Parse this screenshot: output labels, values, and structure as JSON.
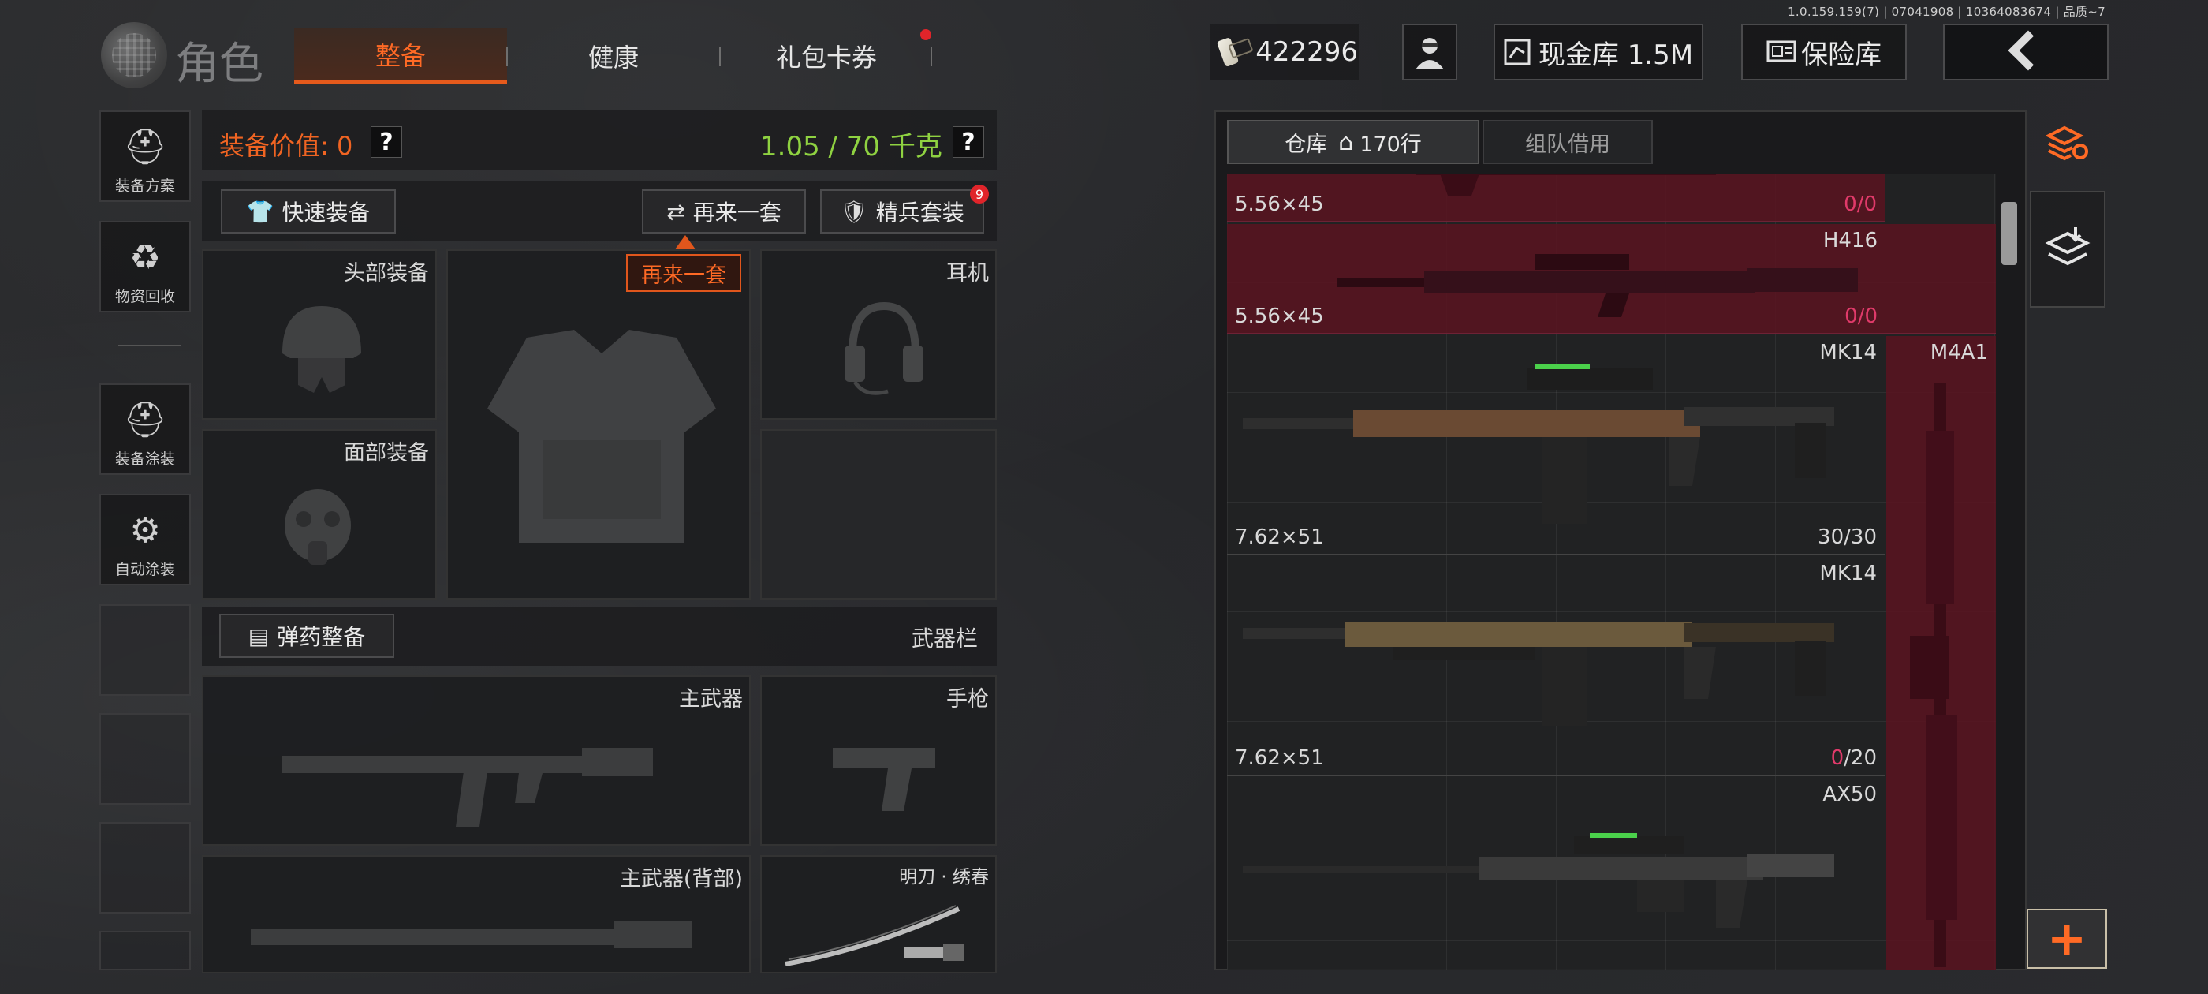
{
  "version": "1.0.159.159(7) | 07041908 | 10364083674 | 品质~7",
  "header": {
    "title": "角色",
    "tabs": [
      {
        "label": "整备",
        "active": true
      },
      {
        "label": "健康",
        "active": false
      },
      {
        "label": "礼包卡券",
        "active": false,
        "has_notification": true
      }
    ],
    "currency": "422296",
    "cash_vault": "现金库 1.5M",
    "safe_box": "保险库"
  },
  "sidebar": {
    "items": [
      {
        "label": "装备方案",
        "icon": "helmet-grid-icon"
      },
      {
        "label": "物资回收",
        "icon": "recycle-face-icon"
      },
      {
        "label": "装备涂装",
        "icon": "helmet-brush-icon"
      },
      {
        "label": "自动涂装",
        "icon": "brush-gear-icon"
      }
    ]
  },
  "equipment": {
    "value_label": "装备价值: 0",
    "weight_label": "1.05 / 70 千克",
    "help_symbol": "?",
    "quick_equip": "快速装备",
    "again_set": "再来一套",
    "elite_set": "精兵套装",
    "elite_badge": "9",
    "tooltip": "再来一套",
    "slots": {
      "head": "头部装备",
      "headset": "耳机",
      "face": "面部装备",
      "primary": "主武器",
      "pistol": "手枪",
      "primary_back": "主武器(背部)",
      "melee": "明刀 · 绣春"
    },
    "ammo_button": "弹药整备",
    "weapon_bar": "武器栏"
  },
  "warehouse": {
    "tabs": [
      {
        "label": "仓库",
        "suffix": "170行",
        "active": true
      },
      {
        "label": "组队借用",
        "active": false
      }
    ],
    "items": [
      {
        "name": "",
        "caliber": "5.56×45",
        "ammo_current": "0",
        "ammo_max": "0",
        "highlight": true
      },
      {
        "name": "H416",
        "caliber": "5.56×45",
        "ammo_current": "0",
        "ammo_max": "0",
        "highlight": true
      },
      {
        "name": "MK14",
        "caliber": "7.62×51",
        "ammo_current": "30",
        "ammo_max": "30",
        "highlight": false
      },
      {
        "name": "MK14",
        "caliber": "7.62×51",
        "ammo_current": "0",
        "ammo_max": "20",
        "highlight": false
      },
      {
        "name": "AX50",
        "caliber": "",
        "ammo_current": "",
        "ammo_max": "",
        "highlight": false
      }
    ],
    "side_item": "M4A1",
    "add_symbol": "+"
  },
  "colors": {
    "accent": "#ff6a25",
    "weight_ok": "#8fd241",
    "warning_red": "#e03a6a",
    "highlight_row": "#5c1220"
  }
}
